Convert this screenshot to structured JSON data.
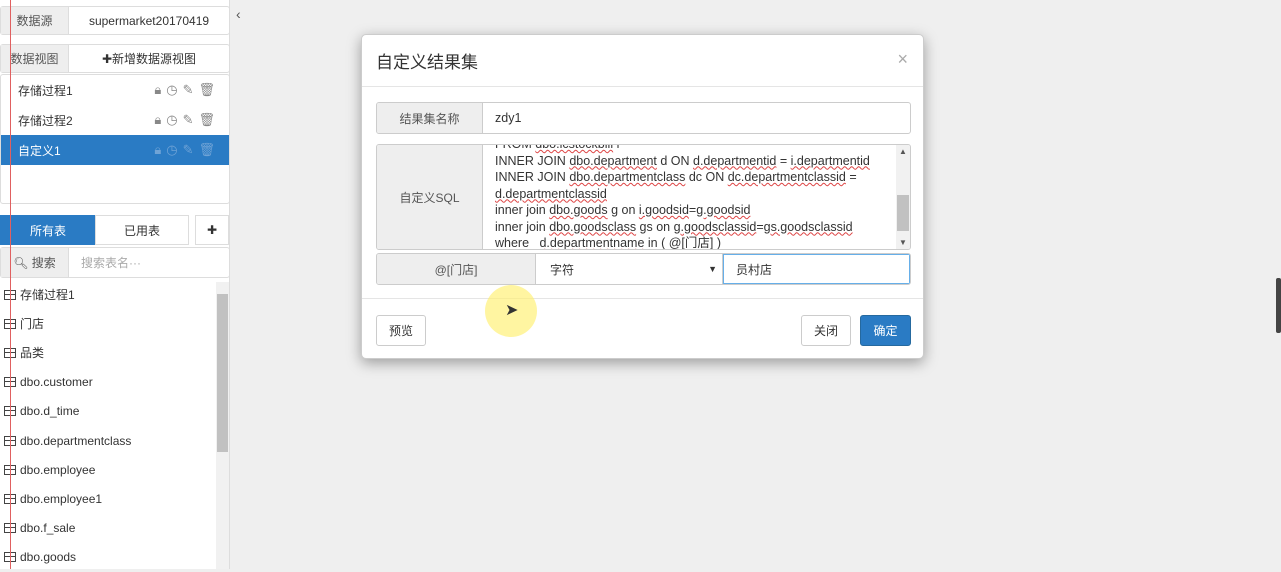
{
  "left": {
    "datasource_label": "数据源",
    "datasource_value": "supermarket20170419",
    "dataview_label": "数据视图",
    "add_view_button": "✚新增数据源视图",
    "views": [
      {
        "label": "存储过程1"
      },
      {
        "label": "存储过程2"
      },
      {
        "label": "自定义1",
        "active": true
      }
    ],
    "tabs": [
      "所有表",
      "已用表"
    ],
    "add_button": "✚",
    "search_label": "搜索",
    "search_placeholder": "搜索表名···",
    "tables": [
      "存储过程1",
      "门店",
      "品类",
      "dbo.customer",
      "dbo.d_time",
      "dbo.departmentclass",
      "dbo.employee",
      "dbo.employee1",
      "dbo.f_sale",
      "dbo.goods"
    ]
  },
  "collapse_icon": "‹",
  "modal": {
    "title": "自定义结果集",
    "close": "×",
    "name_label": "结果集名称",
    "name_value": "zdy1",
    "sql_label": "自定义SQL",
    "param_label": "@[门店]",
    "param_type": "字符",
    "param_value": "员村店",
    "preview_button": "预览",
    "close_button": "关闭",
    "confirm_button": "确定"
  }
}
